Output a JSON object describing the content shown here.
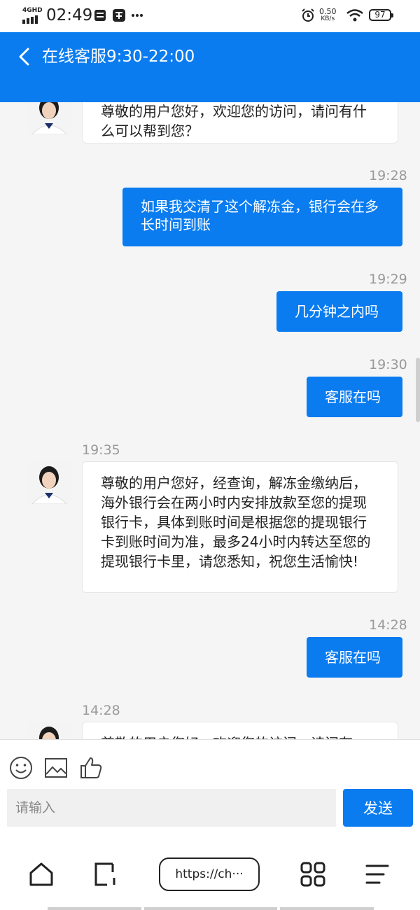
{
  "status_bar": {
    "network": "4GHD",
    "time": "02:49",
    "speed_value": "0.50",
    "speed_unit": "KB/s",
    "battery": "97",
    "icons": [
      "signal-icon",
      "sim-card-icon",
      "app-icon",
      "more-dots-icon",
      "alarm-icon",
      "wifi-icon",
      "battery-icon"
    ]
  },
  "header": {
    "title": "在线客服9:30-22:00"
  },
  "messages": [
    {
      "side": "in",
      "text": "尊敬的用户您好，欢迎您的访问，请问有什么可以帮到您？"
    },
    {
      "side": "out",
      "time": "19:28",
      "text": "如果我交清了这个解冻金，银行会在多长时间到账"
    },
    {
      "side": "out",
      "time": "19:29",
      "text": "几分钟之内吗"
    },
    {
      "side": "out",
      "time": "19:30",
      "text": "客服在吗"
    },
    {
      "side": "in",
      "time": "19:35",
      "text": "尊敬的用户您好，经查询，解冻金缴纳后，海外银行会在两小时内安排放款至您的提现银行卡，具体到账时间是根据您的提现银行卡到账时间为准，最多24小时内转达至您的提现银行卡里，请您悉知，祝您生活愉快!"
    },
    {
      "side": "out",
      "time": "14:28",
      "text": "客服在吗"
    },
    {
      "side": "in",
      "time": "14:28",
      "text": "尊敬的用户您好，欢迎您的访问，请问有"
    }
  ],
  "input": {
    "placeholder": "请输入",
    "send_label": "发送",
    "tools": [
      "emoji-icon",
      "image-icon",
      "thumbs-up-icon"
    ]
  },
  "browser_nav": {
    "url": "https://ch···",
    "icons": [
      "home-icon",
      "tabs-icon",
      "apps-grid-icon",
      "menu-icon"
    ]
  },
  "colors": {
    "accent": "#0a7cf0",
    "background": "#f5f5f5",
    "timestamp": "#999999"
  }
}
